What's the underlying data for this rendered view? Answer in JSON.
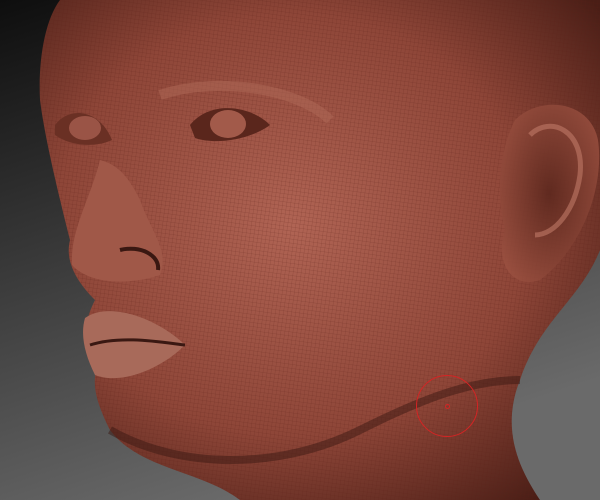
{
  "viewport": {
    "background_top": "#0e0e0e",
    "background_bottom": "#6a6a6a",
    "mesh_color": "#8e4638",
    "mesh_shadow": "#3a1812",
    "mesh_highlight": "#c07a68",
    "wire_color": "#5a2018"
  },
  "brush": {
    "icon": "brush-cursor-icon",
    "color": "#d42424"
  }
}
